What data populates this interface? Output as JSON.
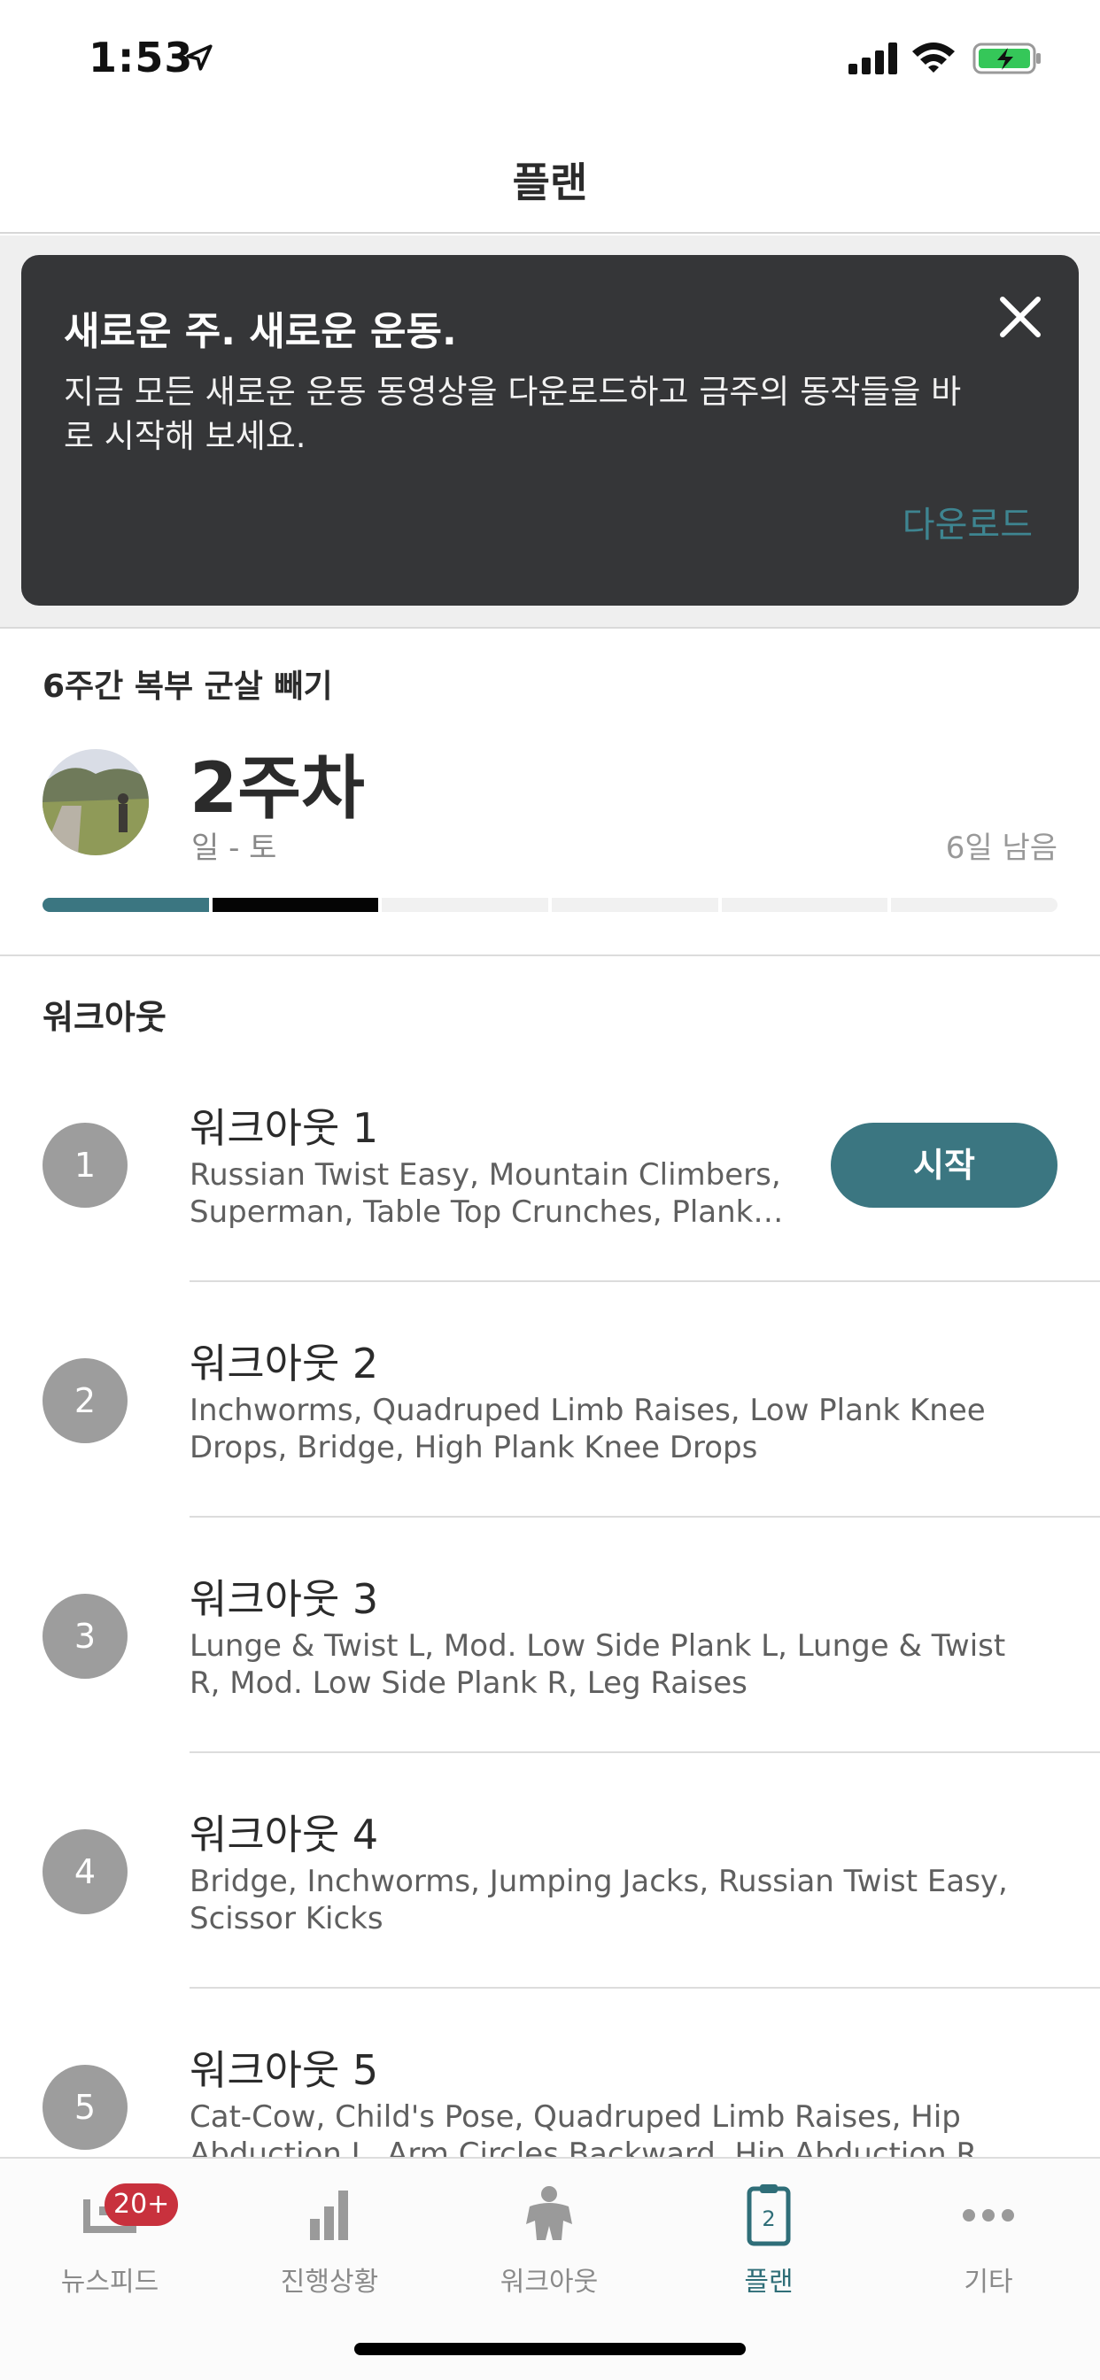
{
  "status_bar": {
    "time": "1:53"
  },
  "header": {
    "title": "플랜"
  },
  "banner": {
    "title": "새로운 주. 새로운 운동.",
    "body": "지금 모든 새로운 운동 동영상을 다운로드하고 금주의 동작들을 바로 시작해 보세요.",
    "download_label": "다운로드"
  },
  "plan": {
    "program_title": "6주간 복부 군살 빼기",
    "week_title": "2주차",
    "week_range": "일 - 토",
    "days_remaining": "6일 남음",
    "progress": {
      "total_weeks": 6,
      "completed_weeks": 1,
      "current_week": 2
    }
  },
  "workouts_section": {
    "title": "워크아웃"
  },
  "workouts": [
    {
      "number": "1",
      "name": "워크아웃 1",
      "exercises": "Russian Twist Easy, Mountain Climbers, Superman, Table Top Crunches, Plank…",
      "start_label": "시작"
    },
    {
      "number": "2",
      "name": "워크아웃 2",
      "exercises": "Inchworms, Quadruped Limb Raises, Low Plank Knee Drops, Bridge, High Plank Knee Drops"
    },
    {
      "number": "3",
      "name": "워크아웃 3",
      "exercises": "Lunge & Twist L, Mod. Low Side Plank L, Lunge & Twist R, Mod. Low Side Plank R, Leg Raises"
    },
    {
      "number": "4",
      "name": "워크아웃 4",
      "exercises": "Bridge, Inchworms, Jumping Jacks, Russian Twist Easy, Scissor Kicks"
    },
    {
      "number": "5",
      "name": "워크아웃 5",
      "exercises": "Cat-Cow, Child's Pose, Quadruped Limb Raises, Hip Abduction L, Arm Circles Backward, Hip Abduction R"
    }
  ],
  "tab_bar": {
    "tabs": [
      {
        "label": "뉴스피드",
        "icon": "newsfeed-icon",
        "badge": "20+"
      },
      {
        "label": "진행상황",
        "icon": "bar-chart-icon"
      },
      {
        "label": "워크아웃",
        "icon": "person-icon"
      },
      {
        "label": "플랜",
        "icon": "clipboard-icon",
        "icon_text": "2",
        "active": true
      },
      {
        "label": "기타",
        "icon": "more-dots-icon"
      }
    ]
  },
  "colors": {
    "accent": "#3b7681",
    "banner_bg": "#353638",
    "badge": "#c8313d",
    "download_link": "#3e8591"
  }
}
